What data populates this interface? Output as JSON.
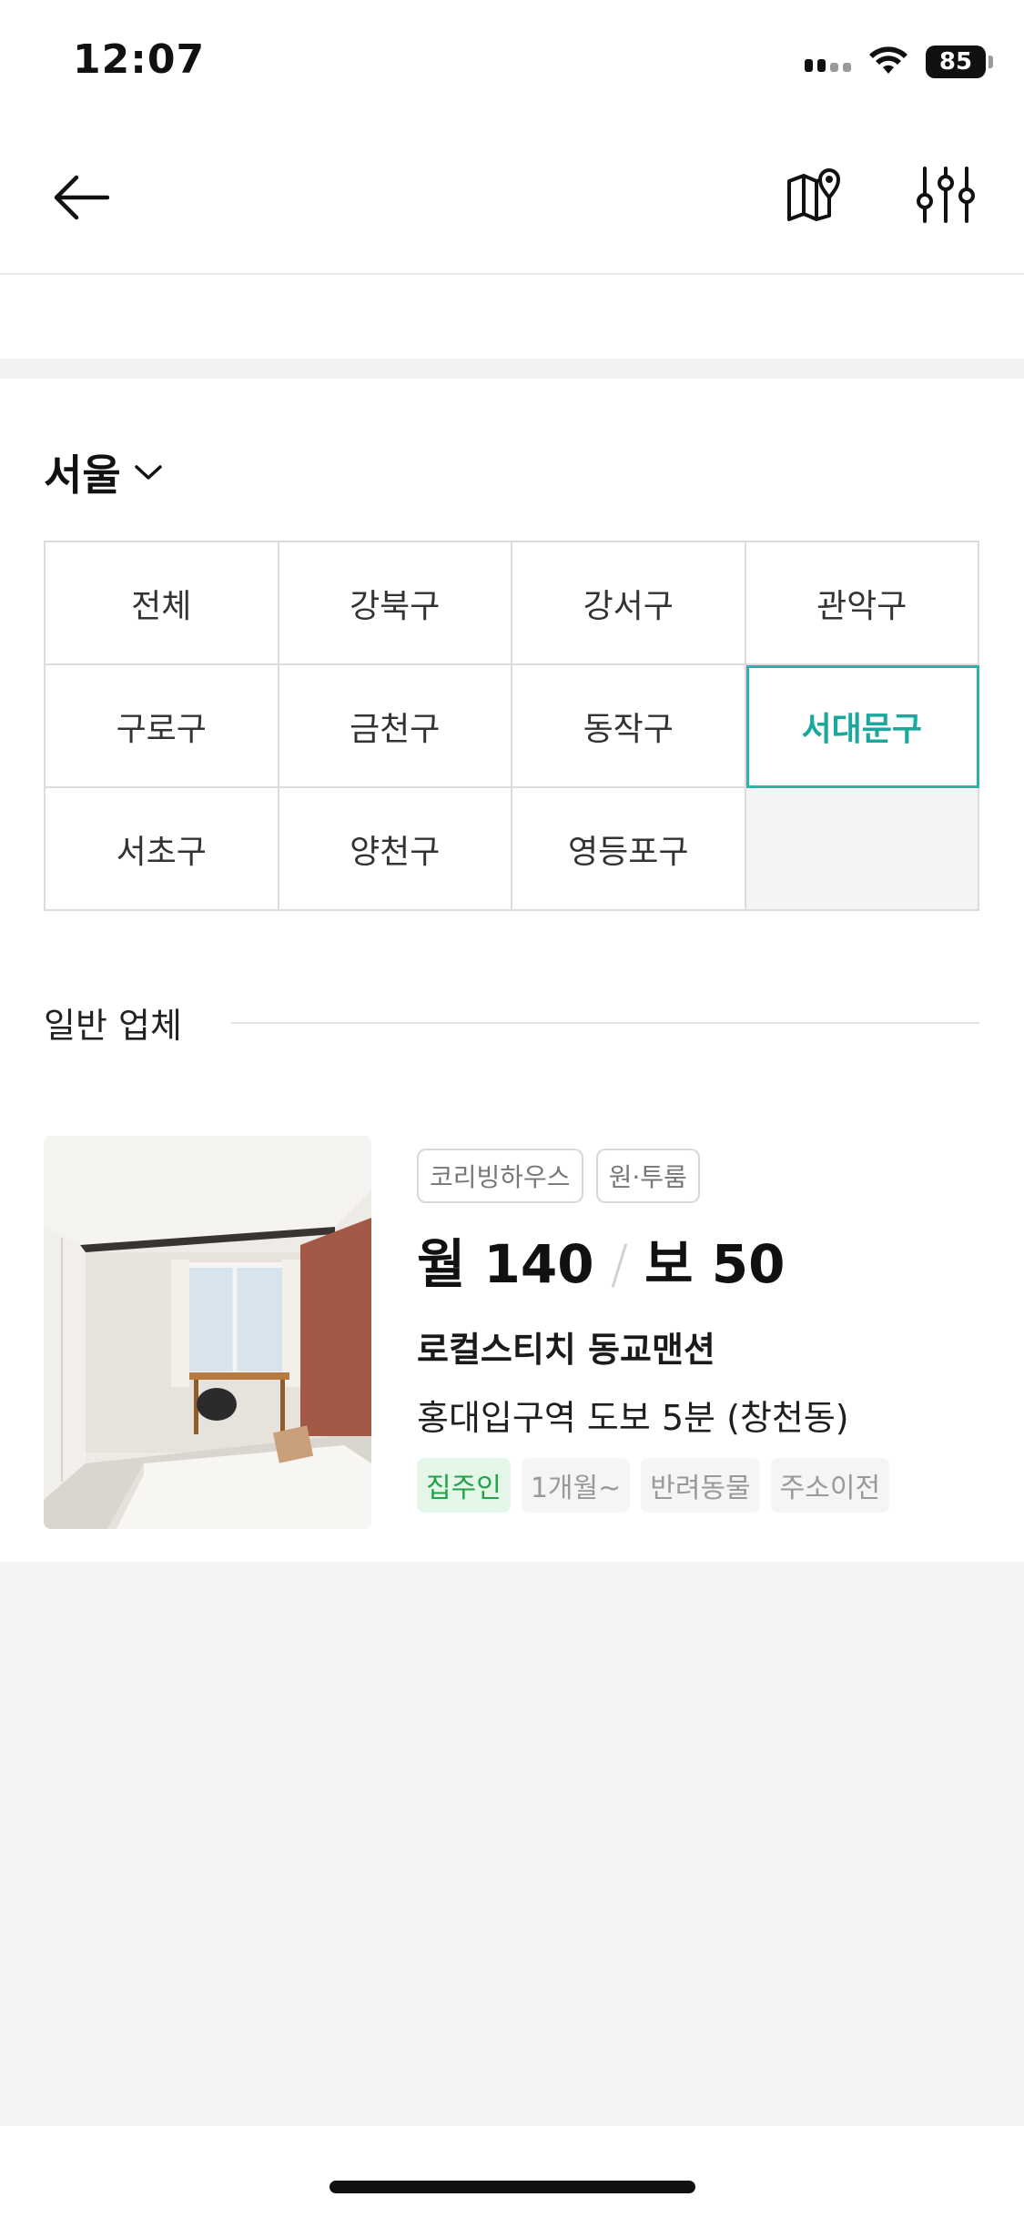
{
  "status_bar": {
    "time": "12:07",
    "battery": "85"
  },
  "header": {
    "back_icon": "arrow-left-icon",
    "map_icon": "map-pin-icon",
    "filter_icon": "sliders-icon"
  },
  "region": {
    "city": "서울",
    "districts": [
      "전체",
      "강북구",
      "강서구",
      "관악구",
      "구로구",
      "금천구",
      "동작구",
      "서대문구",
      "서초구",
      "양천구",
      "영등포구"
    ],
    "selected": "서대문구"
  },
  "section": {
    "title": "일반 업체"
  },
  "listing": {
    "tags": [
      "코리빙하우스",
      "원·투룸"
    ],
    "price_monthly": "월 140",
    "price_deposit": "보 50",
    "name": "로컬스티치 동교맨션",
    "location": "홍대입구역 도보 5분 (창천동)",
    "features": [
      "집주인",
      "1개월~",
      "반려동물",
      "주소이전"
    ]
  },
  "colors": {
    "accent": "#1aa89d",
    "highlight_green": "#22a34a"
  }
}
